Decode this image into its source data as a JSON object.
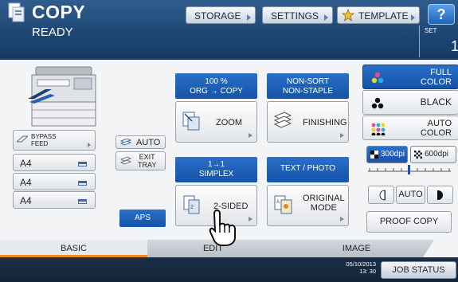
{
  "header": {
    "title": "COPY",
    "status": "READY",
    "buttons": {
      "storage": "STORAGE",
      "settings": "SETTINGS",
      "template": "TEMPLATE",
      "help": "?"
    },
    "set_label": "SET",
    "set_value": "1"
  },
  "paper": {
    "bypass": "BYPASS\nFEED",
    "trays": [
      "A4",
      "A4",
      "A4"
    ],
    "auto": "AUTO",
    "exit_tray": "EXIT\nTRAY",
    "aps": "APS"
  },
  "functions": {
    "zoom_info": "100 %\nORG  → COPY",
    "zoom": "ZOOM",
    "finishing_info": "NON-SORT\nNON-STAPLE",
    "finishing": "FINISHING",
    "duplex_info": "1→1\nSIMPLEX",
    "duplex": "2-SIDED",
    "original_info": "TEXT / PHOTO",
    "original": "ORIGINAL\nMODE"
  },
  "color_modes": {
    "full_color": "FULL\nCOLOR",
    "black": "BLACK",
    "auto_color": "AUTO\nCOLOR"
  },
  "resolution": {
    "dpi300": "300dpi",
    "dpi600": "600dpi"
  },
  "density": {
    "auto": "AUTO"
  },
  "proof_copy": "PROOF COPY",
  "tabs": {
    "basic": "BASIC",
    "edit": "EDIT",
    "image": "IMAGE"
  },
  "footer": {
    "date": "05/10/2013",
    "time": "13: 30",
    "job_status": "JOB STATUS"
  },
  "colors": {
    "accent_blue": "#1453a8",
    "tab_accent": "#f08a1c",
    "header_blue": "#1f4774"
  }
}
